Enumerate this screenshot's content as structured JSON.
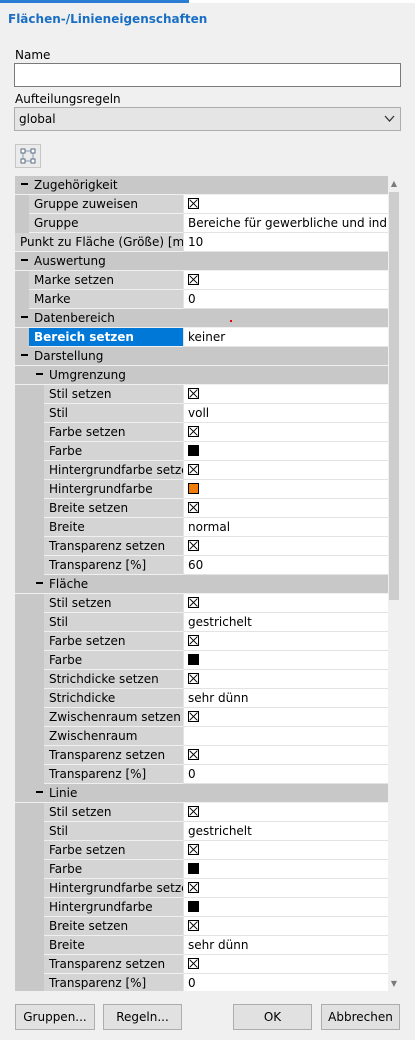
{
  "dialog": {
    "title": "Flächen-/Linieneigenschaften"
  },
  "form": {
    "name_label": "Name",
    "name_value": "",
    "rules_label": "Aufteilungsregeln",
    "rules_value": "global"
  },
  "grid": {
    "rows": [
      {
        "type": "group",
        "level": 0,
        "label": "Zugehörigkeit"
      },
      {
        "type": "prop",
        "level": 1,
        "label": "Gruppe zuweisen",
        "value_type": "check"
      },
      {
        "type": "prop",
        "level": 1,
        "label": "Gruppe",
        "value": "Bereiche für gewerbliche und industrielle"
      },
      {
        "type": "prop",
        "level": 0,
        "label": "Punkt zu Fläche (Größe) [m]",
        "value": "10"
      },
      {
        "type": "group",
        "level": 0,
        "label": "Auswertung"
      },
      {
        "type": "prop",
        "level": 1,
        "label": "Marke setzen",
        "value_type": "check"
      },
      {
        "type": "prop",
        "level": 1,
        "label": "Marke",
        "value": "0"
      },
      {
        "type": "group",
        "level": 0,
        "label": "Datenbereich"
      },
      {
        "type": "prop",
        "level": 1,
        "label": "Bereich setzen",
        "value": "keiner",
        "selected": true
      },
      {
        "type": "group",
        "level": 0,
        "label": "Darstellung"
      },
      {
        "type": "group",
        "level": 1,
        "label": "Umgrenzung"
      },
      {
        "type": "prop",
        "level": 2,
        "label": "Stil setzen",
        "value_type": "check"
      },
      {
        "type": "prop",
        "level": 2,
        "label": "Stil",
        "value": "voll"
      },
      {
        "type": "prop",
        "level": 2,
        "label": "Farbe setzen",
        "value_type": "check"
      },
      {
        "type": "prop",
        "level": 2,
        "label": "Farbe",
        "value_type": "color",
        "color": "#000000"
      },
      {
        "type": "prop",
        "level": 2,
        "label": "Hintergrundfarbe setzen",
        "value_type": "check"
      },
      {
        "type": "prop",
        "level": 2,
        "label": "Hintergrundfarbe",
        "value_type": "color",
        "color": "#f07d0a"
      },
      {
        "type": "prop",
        "level": 2,
        "label": "Breite setzen",
        "value_type": "check"
      },
      {
        "type": "prop",
        "level": 2,
        "label": "Breite",
        "value": "normal"
      },
      {
        "type": "prop",
        "level": 2,
        "label": "Transparenz setzen",
        "value_type": "check"
      },
      {
        "type": "prop",
        "level": 2,
        "label": "Transparenz [%]",
        "value": "60"
      },
      {
        "type": "group",
        "level": 1,
        "label": "Fläche"
      },
      {
        "type": "prop",
        "level": 2,
        "label": "Stil setzen",
        "value_type": "check"
      },
      {
        "type": "prop",
        "level": 2,
        "label": "Stil",
        "value": "gestrichelt"
      },
      {
        "type": "prop",
        "level": 2,
        "label": "Farbe setzen",
        "value_type": "check"
      },
      {
        "type": "prop",
        "level": 2,
        "label": "Farbe",
        "value_type": "color",
        "color": "#000000"
      },
      {
        "type": "prop",
        "level": 2,
        "label": "Strichdicke setzen",
        "value_type": "check"
      },
      {
        "type": "prop",
        "level": 2,
        "label": "Strichdicke",
        "value": "sehr dünn"
      },
      {
        "type": "prop",
        "level": 2,
        "label": "Zwischenraum setzen",
        "value_type": "check"
      },
      {
        "type": "prop",
        "level": 2,
        "label": "Zwischenraum",
        "value": ""
      },
      {
        "type": "prop",
        "level": 2,
        "label": "Transparenz setzen",
        "value_type": "check"
      },
      {
        "type": "prop",
        "level": 2,
        "label": "Transparenz [%]",
        "value": "0"
      },
      {
        "type": "group",
        "level": 1,
        "label": "Linie"
      },
      {
        "type": "prop",
        "level": 2,
        "label": "Stil setzen",
        "value_type": "check"
      },
      {
        "type": "prop",
        "level": 2,
        "label": "Stil",
        "value": "gestrichelt"
      },
      {
        "type": "prop",
        "level": 2,
        "label": "Farbe setzen",
        "value_type": "check"
      },
      {
        "type": "prop",
        "level": 2,
        "label": "Farbe",
        "value_type": "color",
        "color": "#000000"
      },
      {
        "type": "prop",
        "level": 2,
        "label": "Hintergrundfarbe setzen",
        "value_type": "check"
      },
      {
        "type": "prop",
        "level": 2,
        "label": "Hintergrundfarbe",
        "value_type": "color",
        "color": "#000000"
      },
      {
        "type": "prop",
        "level": 2,
        "label": "Breite setzen",
        "value_type": "check"
      },
      {
        "type": "prop",
        "level": 2,
        "label": "Breite",
        "value": "sehr dünn"
      },
      {
        "type": "prop",
        "level": 2,
        "label": "Transparenz setzen",
        "value_type": "check"
      },
      {
        "type": "prop",
        "level": 2,
        "label": "Transparenz [%]",
        "value": "0"
      }
    ]
  },
  "buttons": {
    "groups": "Gruppen...",
    "rules": "Regeln...",
    "ok": "OK",
    "cancel": "Abbrechen"
  },
  "colors": {
    "accent": "#1a6fc4",
    "selection": "#0078d7",
    "orange_swatch": "#f07d0a"
  }
}
